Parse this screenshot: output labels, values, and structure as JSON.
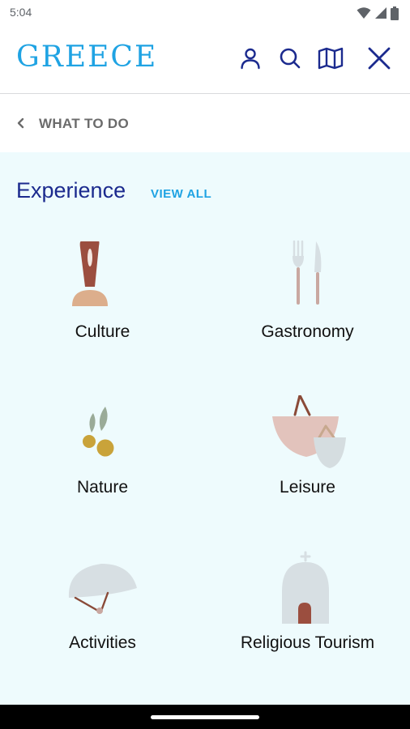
{
  "status_bar": {
    "time": "5:04",
    "icons": [
      "wifi-icon",
      "signal-icon",
      "battery-icon"
    ]
  },
  "header": {
    "logo_text": "GREECE",
    "actions": [
      {
        "name": "profile-icon"
      },
      {
        "name": "search-icon"
      },
      {
        "name": "map-icon"
      },
      {
        "name": "close-icon"
      }
    ],
    "brand_color": "#1fa3e3",
    "icon_color": "#1b2a8e"
  },
  "breadcrumb": {
    "back_icon": "chevron-left-icon",
    "label": "WHAT TO DO"
  },
  "section": {
    "title": "Experience",
    "view_all_label": "VIEW ALL",
    "background": "#eefbfd"
  },
  "categories": [
    {
      "label": "Culture",
      "icon": "culture-icon"
    },
    {
      "label": "Gastronomy",
      "icon": "cutlery-icon"
    },
    {
      "label": "Nature",
      "icon": "olive-icon"
    },
    {
      "label": "Leisure",
      "icon": "bags-icon"
    },
    {
      "label": "Activities",
      "icon": "helmet-icon"
    },
    {
      "label": "Religious Tourism",
      "icon": "chapel-icon"
    }
  ]
}
